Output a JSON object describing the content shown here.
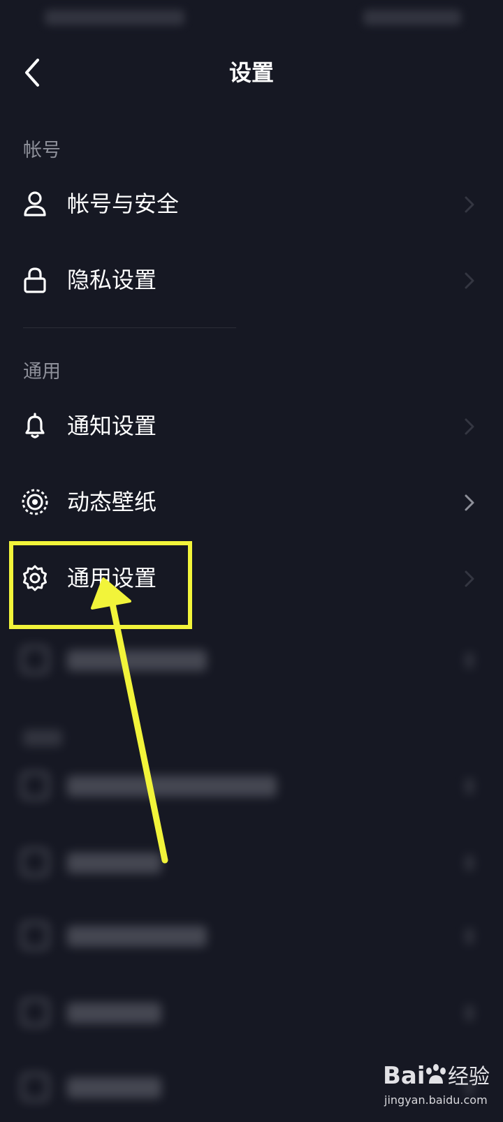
{
  "header": {
    "title": "设置"
  },
  "sections": {
    "account": {
      "title": "帐号",
      "items": [
        {
          "label": "帐号与安全",
          "icon": "user-icon"
        },
        {
          "label": "隐私设置",
          "icon": "lock-icon"
        }
      ]
    },
    "general": {
      "title": "通用",
      "items": [
        {
          "label": "通知设置",
          "icon": "bell-icon"
        },
        {
          "label": "动态壁纸",
          "icon": "dynamic-wallpaper-icon"
        },
        {
          "label": "通用设置",
          "icon": "gear-icon"
        }
      ]
    }
  },
  "annotation": {
    "highlight_color": "#f2f43a",
    "arrow_color": "#f2f43a"
  },
  "watermark": {
    "brand": "Baidu经验",
    "url": "jingyan.baidu.com"
  },
  "colors": {
    "background": "#161823",
    "text_primary": "#ffffff",
    "text_secondary": "#8e909a"
  }
}
